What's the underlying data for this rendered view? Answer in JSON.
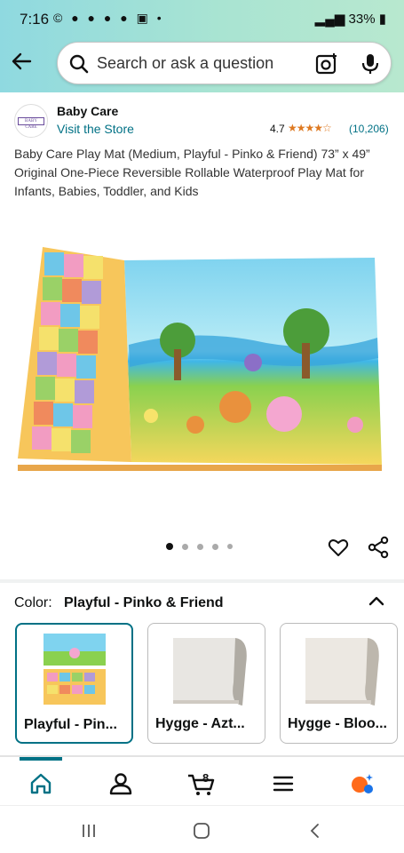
{
  "status_bar": {
    "time": "7:16",
    "notification_icons": "© ● ● ● ● ▣ •",
    "battery_text": "33%"
  },
  "search": {
    "placeholder": "Search or ask a question"
  },
  "brand": {
    "logo_text": "BABY CARE",
    "name": "Baby Care",
    "visit_store": "Visit the Store",
    "rating": "4.7",
    "stars": "★★★★☆",
    "rating_value": 4.7,
    "rating_count": "(10,206)"
  },
  "product": {
    "title": "Baby Care Play Mat (Medium, Playful - Pinko & Friend) 73” x 49” Original One-Piece Reversible Rollable Waterproof Play Mat for Infants, Babies, Toddler, and Kids"
  },
  "carousel": {
    "dot_count": 5,
    "active_index": 0
  },
  "color": {
    "label": "Color:",
    "selected_value": "Playful - Pinko & Friend"
  },
  "swatches": [
    {
      "label": "Playful - Pin...",
      "selected": true
    },
    {
      "label": "Hygge - Azt...",
      "selected": false
    },
    {
      "label": "Hygge - Bloo...",
      "selected": false
    }
  ],
  "bottom_nav": {
    "cart_count": "8",
    "items": [
      "home-icon",
      "account-icon",
      "cart-icon",
      "menu-icon",
      "rufus-icon"
    ]
  },
  "colors": {
    "link": "#007185",
    "star": "#de7921",
    "nav_active": "#007185"
  }
}
